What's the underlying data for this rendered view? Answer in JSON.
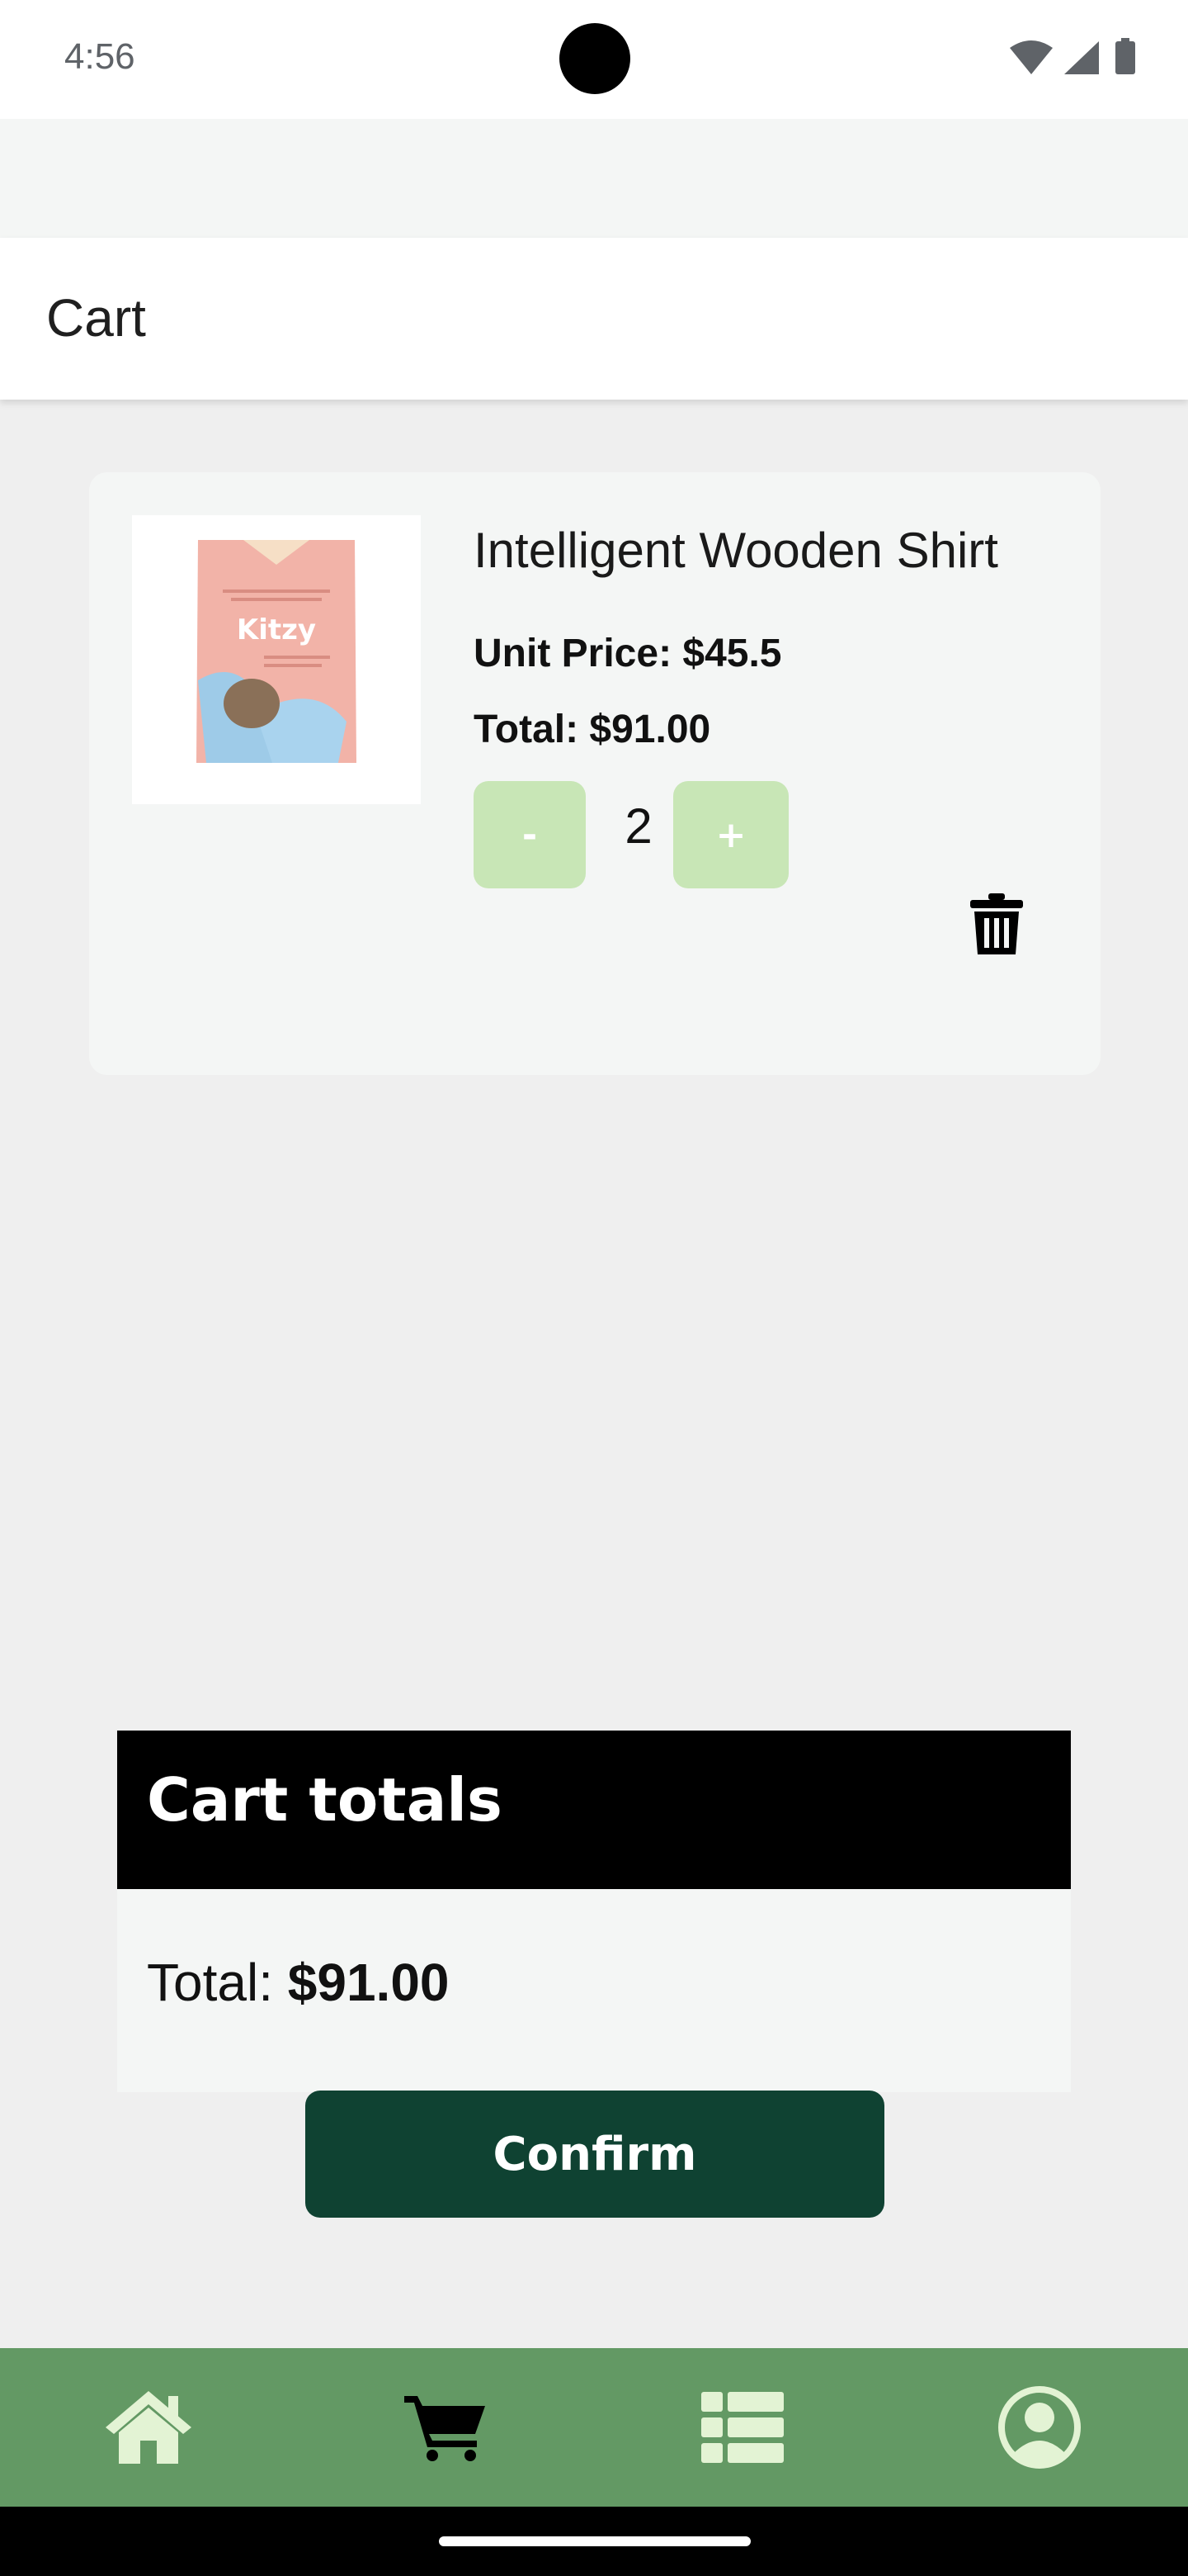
{
  "status_bar": {
    "time": "4:56"
  },
  "app_bar": {
    "title": "Cart"
  },
  "cart_item": {
    "name": "Intelligent Wooden Shirt",
    "unit_price": "Unit Price: $45.5",
    "total": "Total: $91.00",
    "quantity": "2",
    "minus_label": "-",
    "plus_label": "+",
    "image_caption": "Kitzy"
  },
  "totals": {
    "title": "Cart totals",
    "label": "Total: ",
    "value": "$91.00"
  },
  "confirm_label": "Confirm",
  "bottom_nav": [
    "home-icon",
    "cart-icon",
    "list-icon",
    "profile-icon"
  ],
  "colors": {
    "accent_green": "#639964",
    "confirm_green": "#0f4232",
    "qty_button": "#c8e6b6"
  }
}
